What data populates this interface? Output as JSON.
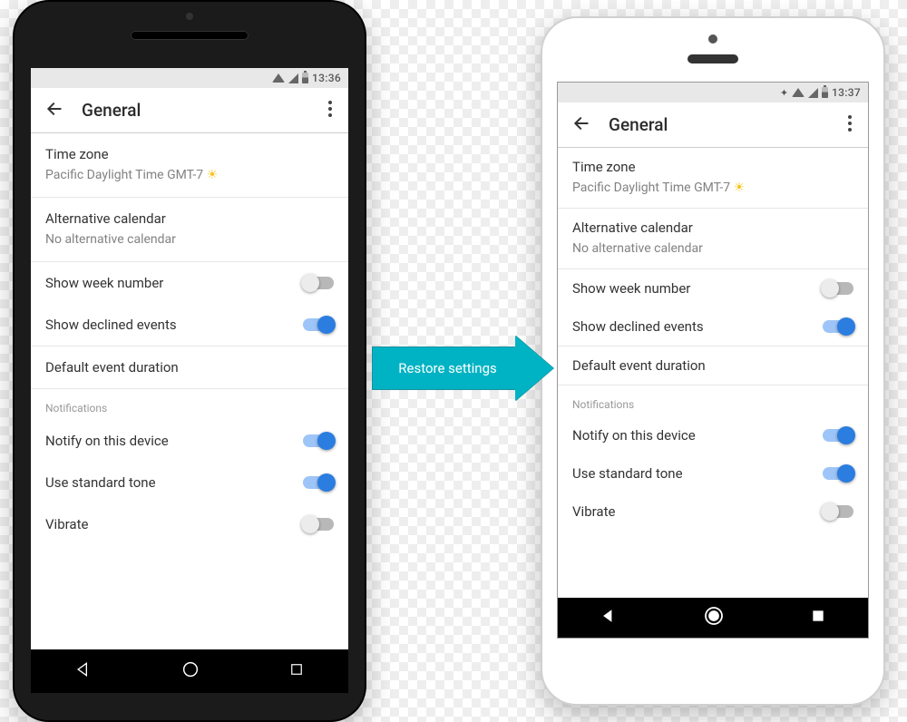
{
  "arrow_label": "Restore settings",
  "left": {
    "status": {
      "time": "13:36",
      "bluetooth": false
    },
    "appbar": {
      "title": "General"
    },
    "settings": {
      "timezone": {
        "label": "Time zone",
        "value": "Pacific Daylight Time  GMT-7"
      },
      "alt_cal": {
        "label": "Alternative calendar",
        "value": "No alternative calendar"
      },
      "week_num": {
        "label": "Show week number",
        "on": false
      },
      "declined": {
        "label": "Show declined events",
        "on": true
      },
      "duration": {
        "label": "Default event duration"
      },
      "section_notifications": "Notifications",
      "notify_device": {
        "label": "Notify on this device",
        "on": true
      },
      "std_tone": {
        "label": "Use standard tone",
        "on": true
      },
      "vibrate": {
        "label": "Vibrate",
        "on": false
      }
    }
  },
  "right": {
    "status": {
      "time": "13:37",
      "bluetooth": true
    },
    "appbar": {
      "title": "General"
    },
    "settings": {
      "timezone": {
        "label": "Time zone",
        "value": "Pacific Daylight Time  GMT-7"
      },
      "alt_cal": {
        "label": "Alternative calendar",
        "value": "No alternative calendar"
      },
      "week_num": {
        "label": "Show week number",
        "on": false
      },
      "declined": {
        "label": "Show declined events",
        "on": true
      },
      "duration": {
        "label": "Default event duration"
      },
      "section_notifications": "Notifications",
      "notify_device": {
        "label": "Notify on this device",
        "on": true
      },
      "std_tone": {
        "label": "Use standard tone",
        "on": true
      },
      "vibrate": {
        "label": "Vibrate",
        "on": false
      }
    }
  }
}
